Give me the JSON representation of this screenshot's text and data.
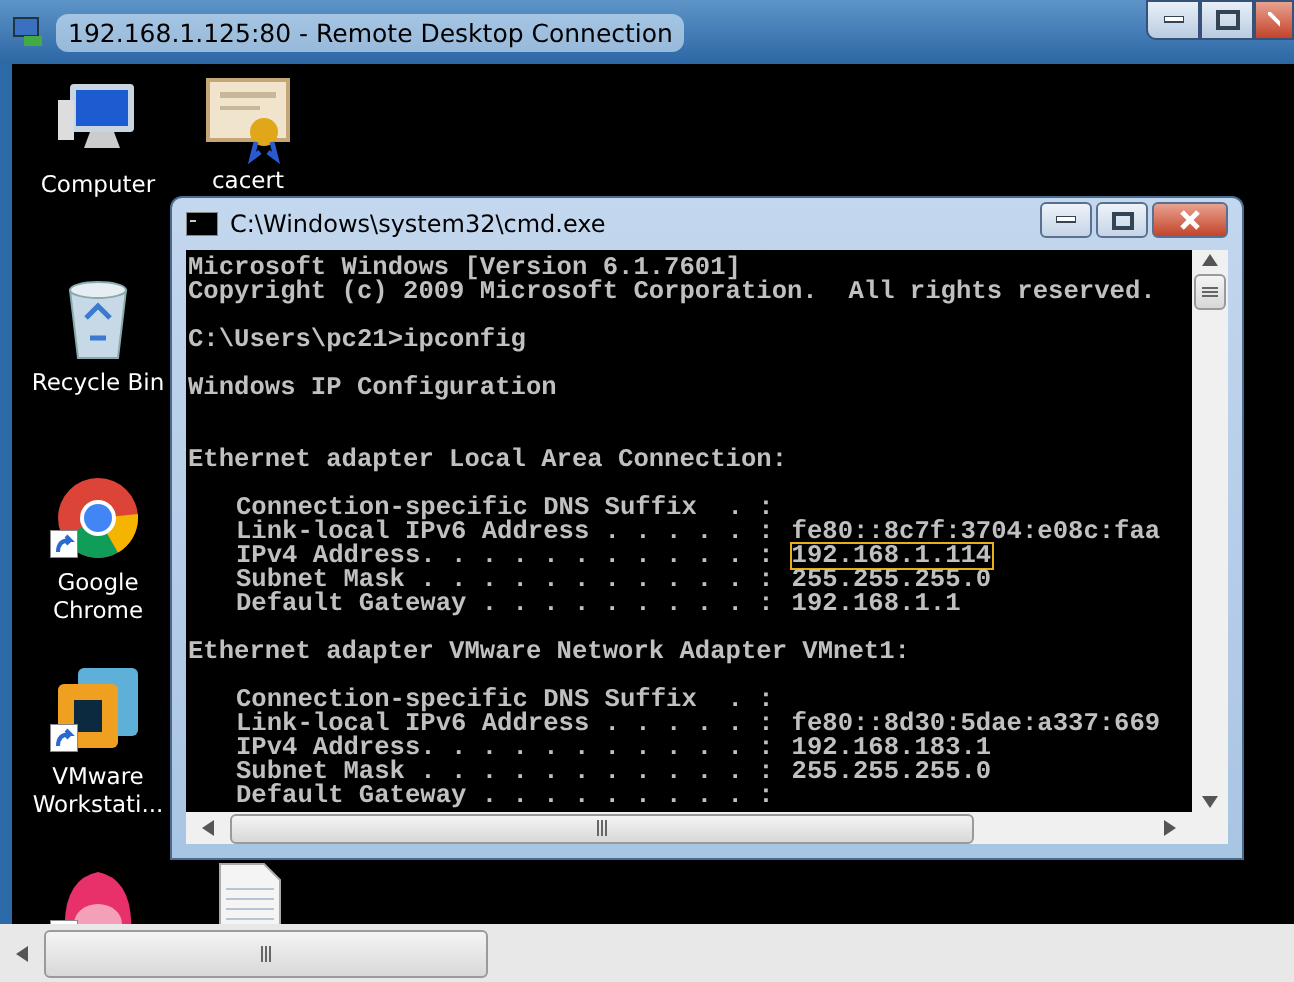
{
  "window": {
    "title": "192.168.1.125:80 - Remote Desktop Connection"
  },
  "desktop_icons": [
    {
      "kind": "computer",
      "label": "Computer"
    },
    {
      "kind": "certificate",
      "label": "cacert"
    },
    {
      "kind": "recycle-bin",
      "label": "Recycle Bin"
    },
    {
      "kind": "chrome",
      "label": "Google Chrome",
      "shortcut": true
    },
    {
      "kind": "vmware",
      "label": "VMware Workstati...",
      "shortcut": true
    },
    {
      "kind": "creature",
      "shortcut": true
    },
    {
      "kind": "document"
    }
  ],
  "cmd_window": {
    "title": "C:\\Windows\\system32\\cmd.exe",
    "lines": [
      {
        "kind": "text",
        "text": "Microsoft Windows [Version 6.1.7601]"
      },
      {
        "kind": "text",
        "text": "Copyright (c) 2009 Microsoft Corporation.  All rights reserved."
      },
      {
        "kind": "blank"
      },
      {
        "kind": "text",
        "text": "C:\\Users\\pc21>ipconfig"
      },
      {
        "kind": "blank"
      },
      {
        "kind": "text",
        "text": "Windows IP Configuration"
      },
      {
        "kind": "blank"
      },
      {
        "kind": "blank"
      },
      {
        "kind": "text",
        "text": "Ethernet adapter Local Area Connection:"
      },
      {
        "kind": "blank"
      },
      {
        "kind": "field",
        "text": "Connection-specific DNS Suffix  . :"
      },
      {
        "kind": "field",
        "text": "Link-local IPv6 Address . . . . . :",
        "value": "fe80::8c7f:3704:e08c:faa",
        "highlighted": false
      },
      {
        "kind": "field",
        "text": "IPv4 Address. . . . . . . . . . . :",
        "value": "192.168.1.114",
        "highlighted": true
      },
      {
        "kind": "field",
        "text": "Subnet Mask . . . . . . . . . . . :",
        "value": "255.255.255.0",
        "highlighted": false
      },
      {
        "kind": "field",
        "text": "Default Gateway . . . . . . . . . :",
        "value": "192.168.1.1",
        "highlighted": false
      },
      {
        "kind": "blank"
      },
      {
        "kind": "text",
        "text": "Ethernet adapter VMware Network Adapter VMnet1:"
      },
      {
        "kind": "blank"
      },
      {
        "kind": "field",
        "text": "Connection-specific DNS Suffix  . :"
      },
      {
        "kind": "field",
        "text": "Link-local IPv6 Address . . . . . :",
        "value": "fe80::8d30:5dae:a337:669",
        "highlighted": false
      },
      {
        "kind": "field",
        "text": "IPv4 Address. . . . . . . . . . . :",
        "value": "192.168.183.1",
        "highlighted": false
      },
      {
        "kind": "field",
        "text": "Subnet Mask . . . . . . . . . . . :",
        "value": "255.255.255.0",
        "highlighted": false
      },
      {
        "kind": "field",
        "text": "Default Gateway . . . . . . . . . :"
      }
    ]
  }
}
